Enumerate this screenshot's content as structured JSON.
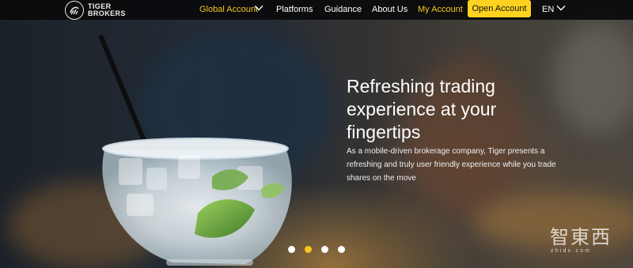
{
  "brand": {
    "logo_line1": "TIGER",
    "logo_line2": "BROKERS"
  },
  "nav": {
    "global_account": "Global Account",
    "platforms": "Platforms",
    "guidance": "Guidance",
    "about_us": "About Us",
    "my_account": "My Account",
    "open_account": "Open Account",
    "language": "EN"
  },
  "hero": {
    "headline_lines": [
      "Refreshing trading",
      "experience at your",
      "fingertips"
    ],
    "subtext_lines": [
      "As a mobile-driven brokerage company, Tiger presents a",
      "refreshing and truly user friendly experience while you trade",
      "shares on the move"
    ]
  },
  "carousel": {
    "slide_count": 4,
    "active_index": 1
  },
  "watermark": {
    "chinese": "智東西",
    "url": "zhidx.com"
  },
  "colors": {
    "accent_yellow": "#ffd21f",
    "nav_yellow_text": "#f6c61f",
    "nav_background": "#0a0a0c"
  },
  "icons": {
    "logo": "tiger-brokers-logo",
    "dropdown": "chevron-down-icon",
    "carousel_dot": "carousel-dot"
  }
}
